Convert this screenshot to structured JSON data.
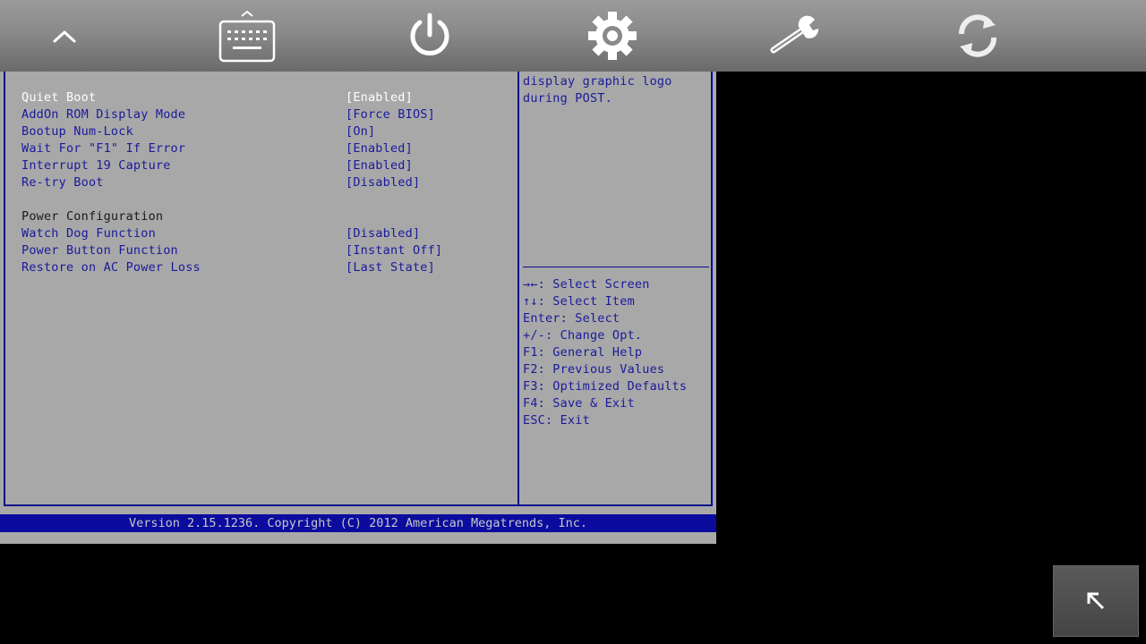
{
  "toolbar": {
    "icons": [
      "chevron-up-icon",
      "keyboard-icon",
      "power-icon",
      "gear-icon",
      "wrench-icon",
      "refresh-icon"
    ]
  },
  "settings": [
    {
      "label": "Quiet Boot",
      "value": "[Enabled]"
    },
    {
      "label": "AddOn ROM Display Mode",
      "value": "[Force BIOS]"
    },
    {
      "label": "Bootup Num-Lock",
      "value": "[On]"
    },
    {
      "label": "Wait For \"F1\" If Error",
      "value": "[Enabled]"
    },
    {
      "label": "Interrupt 19 Capture",
      "value": "[Enabled]"
    },
    {
      "label": "Re-try Boot",
      "value": "[Disabled]"
    }
  ],
  "power_section": {
    "heading": "Power Configuration",
    "settings": [
      {
        "label": "Watch Dog Function",
        "value": "[Disabled]"
      },
      {
        "label": "Power Button Function",
        "value": "[Instant Off]"
      },
      {
        "label": "Restore on AC Power Loss",
        "value": "[Last State]"
      }
    ]
  },
  "help": {
    "description": [
      "display graphic logo",
      "during POST."
    ],
    "keys": [
      "→←: Select Screen",
      "↑↓: Select Item",
      "Enter: Select",
      "+/-: Change Opt.",
      "F1: General Help",
      "F2: Previous Values",
      "F3: Optimized Defaults",
      "F4: Save & Exit",
      "ESC: Exit"
    ]
  },
  "footer": {
    "version": "Version 2.15.1236. Copyright (C) 2012 American Megatrends, Inc."
  },
  "colors": {
    "bios_bg": "#a8a8a8",
    "bios_blue": "#1a1a9c",
    "selected_white": "#ffffff",
    "frame_blue": "#0b0b8e"
  }
}
